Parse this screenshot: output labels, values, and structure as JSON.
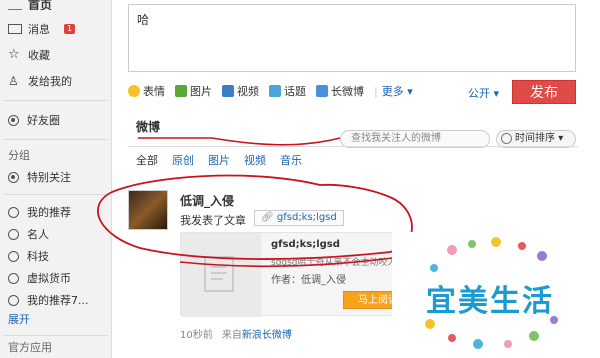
{
  "sidebar": {
    "items": [
      {
        "label": "首页"
      },
      {
        "label": "消息",
        "badge": "1"
      },
      {
        "label": "收藏"
      },
      {
        "label": "发给我的"
      },
      {
        "label": "好友圈"
      }
    ],
    "group_title": "分组",
    "groups": [
      "特别关注",
      "我的推荐",
      "名人",
      "科技",
      "虚拟货币",
      "我的推荐7..."
    ],
    "expand_link": "展开",
    "bottom_title": "官方应用"
  },
  "composer": {
    "text": "哈"
  },
  "toolbar": {
    "tools": [
      "表情",
      "图片",
      "视频",
      "话题",
      "长微博"
    ],
    "more": "更多",
    "public": "公开",
    "post_label": "发布"
  },
  "feed": {
    "title": "微博",
    "search_placeholder": "查找我关注人的微博",
    "sort_label": "时间排序",
    "tabs": [
      "全部",
      "原创",
      "图片",
      "视频",
      "音乐"
    ]
  },
  "post": {
    "username": "低调_入侵",
    "action": "我发表了文章",
    "tag": "gfsd;ks;lgsd",
    "card": {
      "title": "gfsd;ks;lgsd",
      "desc": "sdgsd哈士奇从来不会主动咬人",
      "author": "作者：低调_入侵",
      "read_label": "马上阅读"
    },
    "time": "10秒前",
    "source_prefix": "来自",
    "source": "新浪长微博"
  },
  "watermark": {
    "text": "宜美生活"
  },
  "colors": {
    "accent_red": "#e14b47",
    "link_blue": "#1a66b3",
    "annotation_red": "#c8141e"
  }
}
